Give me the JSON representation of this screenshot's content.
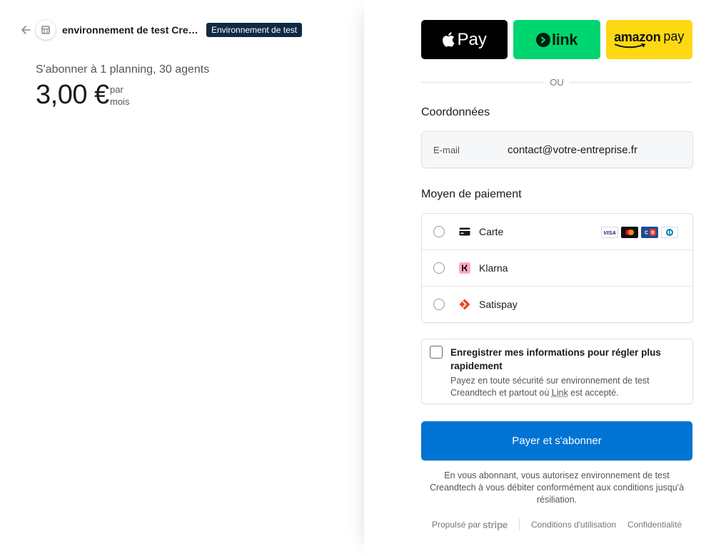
{
  "header": {
    "merchant_name": "environnement de test Crean…",
    "test_badge": "Environnement de test"
  },
  "summary": {
    "subscribe_label": "S'abonner à 1 planning, 30 agents",
    "price": "3,00 €",
    "period_line1": "par",
    "period_line2": "mois"
  },
  "wallets": {
    "apple_pay": "Pay",
    "link": "link",
    "amazon_pay_1": "amazon",
    "amazon_pay_2": "pay"
  },
  "divider_text": "OU",
  "contact": {
    "title": "Coordonnées",
    "email_label": "E-mail",
    "email_value": "contact@votre-entreprise.fr"
  },
  "payment": {
    "title": "Moyen de paiement",
    "methods": [
      {
        "label": "Carte",
        "icon": "card-icon"
      },
      {
        "label": "Klarna",
        "icon": "klarna-icon"
      },
      {
        "label": "Satispay",
        "icon": "satispay-icon"
      }
    ],
    "card_brands": [
      "VISA",
      "mastercard",
      "cb",
      "diners"
    ]
  },
  "save_info": {
    "title": "Enregistrer mes informations pour régler plus rapidement",
    "desc_before": "Payez en toute sécurité sur environnement de test Creandtech et partout où ",
    "desc_link": "Link",
    "desc_after": " est accepté."
  },
  "pay_button": "Payer et s'abonner",
  "legal_text": "En vous abonnant, vous autorisez environnement de test Creandtech à vous débiter conformément aux conditions jusqu'à résiliation.",
  "footer": {
    "powered_by": "Propulsé par",
    "stripe": "stripe",
    "terms": "Conditions d'utilisation",
    "privacy": "Confidentialité"
  },
  "colors": {
    "pay_button": "#0074d4",
    "test_badge_bg": "#0f2a44",
    "link_green": "#00d66f",
    "amazon_yellow": "#ffd814"
  }
}
